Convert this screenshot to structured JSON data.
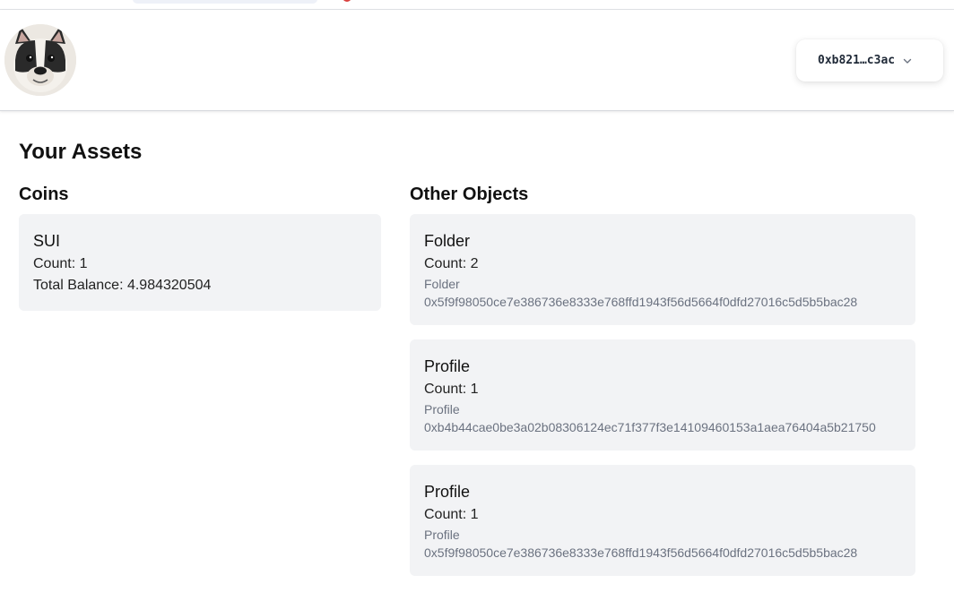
{
  "header": {
    "wallet_address": "0xb821…c3ac",
    "wallet_chevron_icon": "chevron-down-icon",
    "avatar_icon": "bulldog-avatar"
  },
  "page": {
    "title": "Your Assets"
  },
  "coins": {
    "heading": "Coins",
    "items": [
      {
        "name": "SUI",
        "count": "Count: 1",
        "balance": "Total Balance: 4.984320504"
      }
    ]
  },
  "objects": {
    "heading": "Other Objects",
    "items": [
      {
        "name": "Folder",
        "count": "Count: 2",
        "type": "Folder",
        "id": "0x5f9f98050ce7e386736e8333e768ffd1943f56d5664f0dfd27016c5d5b5bac28"
      },
      {
        "name": "Profile",
        "count": "Count: 1",
        "type": "Profile",
        "id": "0xb4b44cae0be3a02b08306124ec71f377f3e14109460153a1aea76404a5b21750"
      },
      {
        "name": "Profile",
        "count": "Count: 1",
        "type": "Profile",
        "id": "0x5f9f98050ce7e386736e8333e768ffd1943f56d5664f0dfd27016c5d5b5bac28"
      }
    ]
  }
}
